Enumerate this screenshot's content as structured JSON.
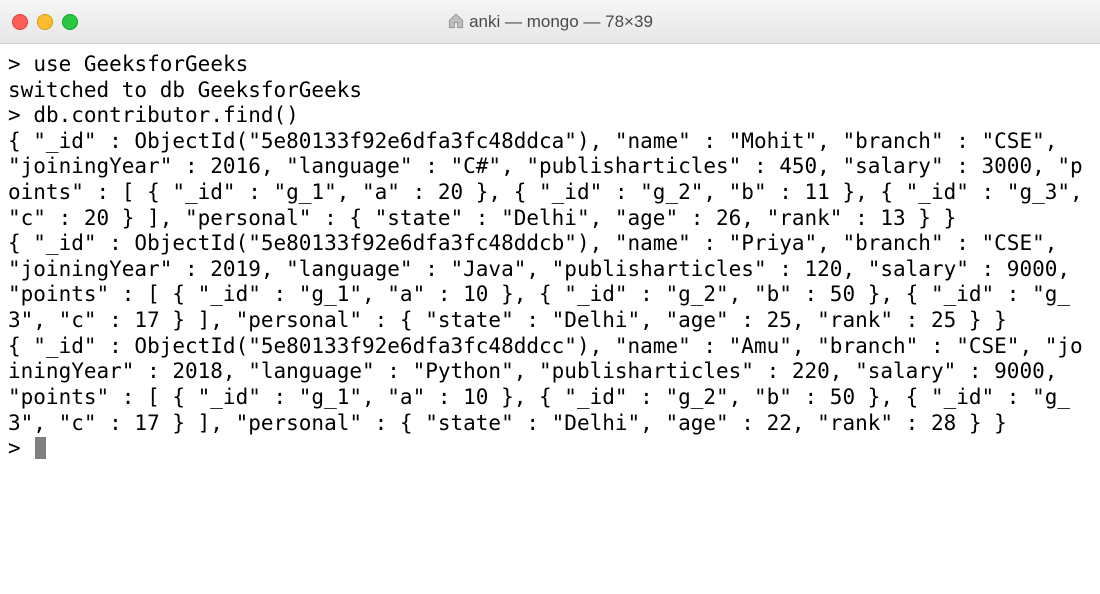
{
  "window": {
    "title_path": "anki — mongo — 78×39"
  },
  "session": {
    "cmd1": "use GeeksforGeeks",
    "out1": "switched to db GeeksforGeeks",
    "cmd2": "db.contributor.find()",
    "doc1": "{ \"_id\" : ObjectId(\"5e80133f92e6dfa3fc48ddca\"), \"name\" : \"Mohit\", \"branch\" : \"CSE\", \"joiningYear\" : 2016, \"language\" : \"C#\", \"publisharticles\" : 450, \"salary\" : 3000, \"points\" : [ { \"_id\" : \"g_1\", \"a\" : 20 }, { \"_id\" : \"g_2\", \"b\" : 11 }, { \"_id\" : \"g_3\", \"c\" : 20 } ], \"personal\" : { \"state\" : \"Delhi\", \"age\" : 26, \"rank\" : 13 } }",
    "doc2": "{ \"_id\" : ObjectId(\"5e80133f92e6dfa3fc48ddcb\"), \"name\" : \"Priya\", \"branch\" : \"CSE\", \"joiningYear\" : 2019, \"language\" : \"Java\", \"publisharticles\" : 120, \"salary\" : 9000, \"points\" : [ { \"_id\" : \"g_1\", \"a\" : 10 }, { \"_id\" : \"g_2\", \"b\" : 50 }, { \"_id\" : \"g_3\", \"c\" : 17 } ], \"personal\" : { \"state\" : \"Delhi\", \"age\" : 25, \"rank\" : 25 } }",
    "doc3": "{ \"_id\" : ObjectId(\"5e80133f92e6dfa3fc48ddcc\"), \"name\" : \"Amu\", \"branch\" : \"CSE\", \"joiningYear\" : 2018, \"language\" : \"Python\", \"publisharticles\" : 220, \"salary\" : 9000, \"points\" : [ { \"_id\" : \"g_1\", \"a\" : 10 }, { \"_id\" : \"g_2\", \"b\" : 50 }, { \"_id\" : \"g_3\", \"c\" : 17 } ], \"personal\" : { \"state\" : \"Delhi\", \"age\" : 22, \"rank\" : 28 } }",
    "prompt": ">"
  }
}
